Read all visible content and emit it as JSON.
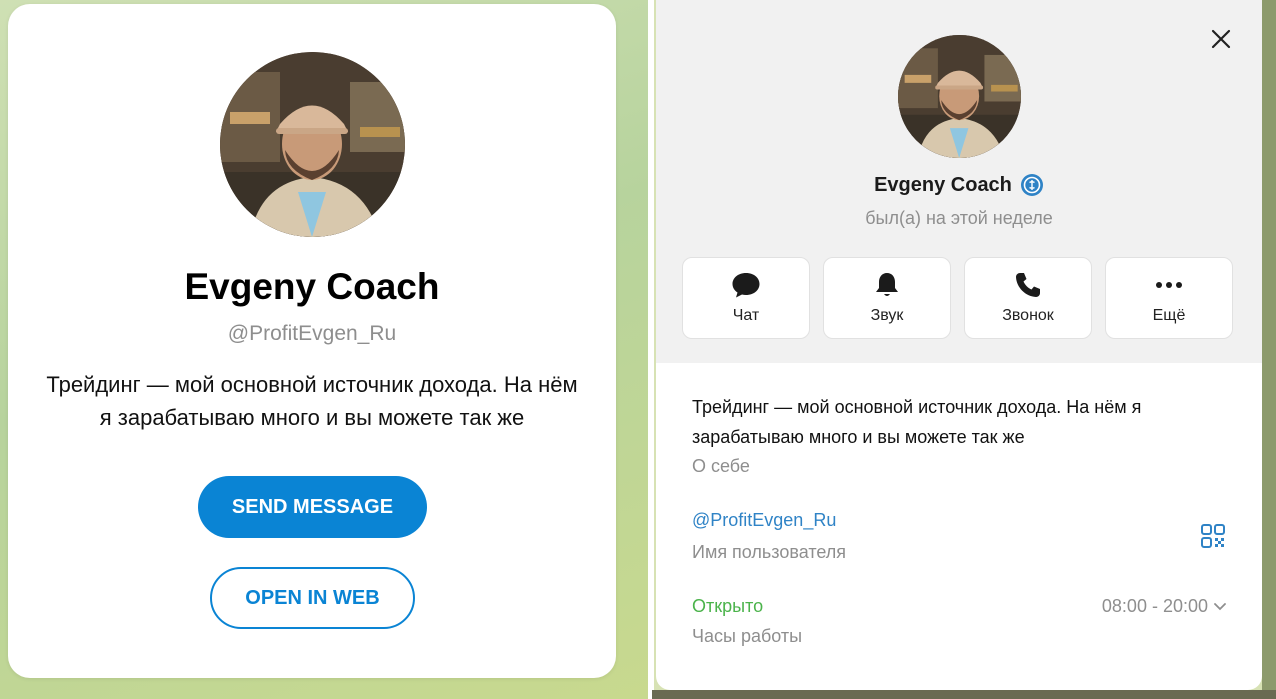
{
  "left_card": {
    "name": "Evgeny Coach",
    "username": "@ProfitEvgen_Ru",
    "bio": "Трейдинг — мой основной источник дохода. На нём я зарабатываю много и вы можете так же",
    "send_button": "SEND MESSAGE",
    "open_button": "OPEN IN WEB"
  },
  "right_panel": {
    "name": "Evgeny Coach",
    "status": "был(а) на этой неделе",
    "actions": [
      {
        "label": "Чат",
        "icon": "chat-icon"
      },
      {
        "label": "Звук",
        "icon": "bell-icon"
      },
      {
        "label": "Звонок",
        "icon": "phone-icon"
      },
      {
        "label": "Ещё",
        "icon": "more-icon"
      }
    ],
    "bio": "Трейдинг — мой основной источник дохода. На нём я зарабатываю много и вы можете так же",
    "bio_label": "О себе",
    "username": "@ProfitEvgen_Ru",
    "username_label": "Имя пользователя",
    "open_status": "Открыто",
    "hours": "08:00 - 20:00",
    "hours_label": "Часы работы"
  },
  "colors": {
    "accent": "#0a84d4",
    "link": "#2f83c6",
    "open": "#4bb34b",
    "secondary_text": "#8e8e8e"
  }
}
